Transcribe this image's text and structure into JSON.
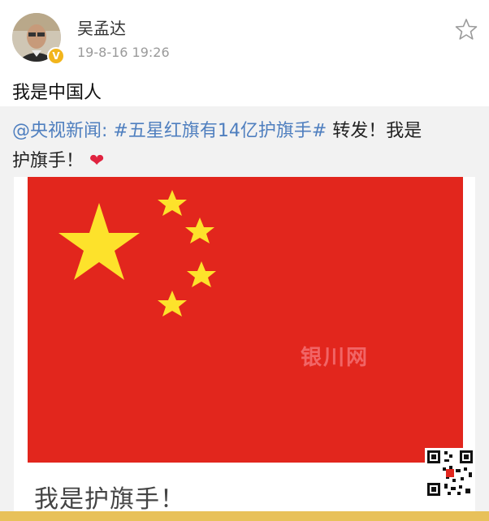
{
  "post": {
    "author": "吴孟达",
    "time": "19-8-16 19:26",
    "text": "我是中国人",
    "verified": true
  },
  "repost": {
    "mention": "@央视新闻:",
    "topic": "#五星红旗有14亿护旗手#",
    "text_a": "转发！我是",
    "text_b": "护旗手！",
    "heart_icon": "heart-icon",
    "image": {
      "flag_red": "#e2261d",
      "star_yellow": "#fde22b",
      "caption": "我是护旗手！"
    }
  },
  "watermark": {
    "brand_mark": "银川网",
    "qr_icon": "qr-code-icon"
  },
  "colors": {
    "link_blue": "#4f7fbf",
    "meta_gray": "#9a9a9a",
    "repost_bg": "#f2f2f2"
  }
}
